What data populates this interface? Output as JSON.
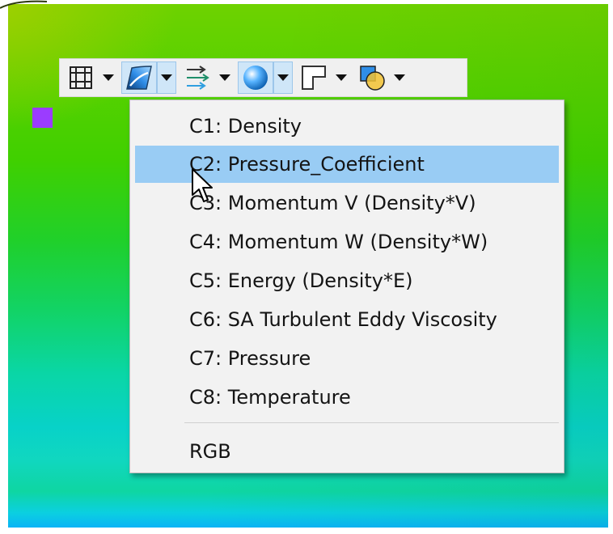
{
  "toolbar": {
    "buttons": [
      {
        "icon": "grid-icon",
        "active": false
      },
      {
        "icon": "contour-shading-icon",
        "active": true
      },
      {
        "icon": "vector-field-icon",
        "active": false
      },
      {
        "icon": "sphere-lighting-icon",
        "active": true
      },
      {
        "icon": "corner-frame-icon",
        "active": false
      },
      {
        "icon": "overlap-shapes-icon",
        "active": false
      }
    ]
  },
  "menu": {
    "items": [
      {
        "label": "C1: Density"
      },
      {
        "label": "C2: Pressure_Coefficient",
        "highlighted": true
      },
      {
        "label": "C3: Momentum V (Density*V)"
      },
      {
        "label": "C4: Momentum W (Density*W)"
      },
      {
        "label": "C5: Energy (Density*E)"
      },
      {
        "label": "C6: SA Turbulent Eddy Viscosity"
      },
      {
        "label": "C7: Pressure"
      },
      {
        "label": "C8: Temperature"
      }
    ],
    "extra_item": {
      "label": "RGB"
    }
  },
  "colors": {
    "highlight": "#99ccf4",
    "marker": "#9b3cff",
    "menu_bg": "#f2f2f2"
  }
}
